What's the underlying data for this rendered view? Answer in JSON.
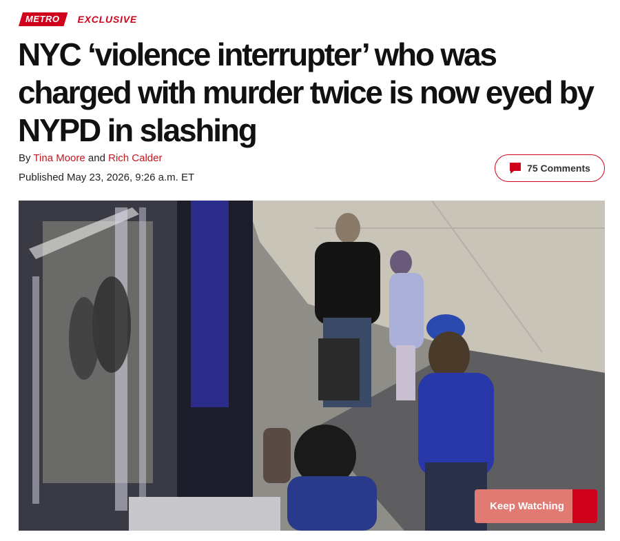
{
  "kicker": {
    "section": "METRO",
    "label": "EXCLUSIVE"
  },
  "article": {
    "headline": "NYC ‘violence interrupter’ who was charged with murder twice is now eyed by NYPD in slashing",
    "byline_prefix": "By",
    "author_1": "Tina Moore",
    "byline_joiner": "and",
    "author_2": "Rich Calder",
    "published": "Published May 23, 2026, 9:26 a.m. ET"
  },
  "comments": {
    "label": "75 Comments"
  },
  "video": {
    "keep_watching_label": "Keep Watching"
  },
  "colors": {
    "brand_red": "#d0021b",
    "author_link": "#c4161c",
    "keep_watching_bg": "#e07a72"
  },
  "icons": {
    "comment": "comment-bubble-icon"
  }
}
